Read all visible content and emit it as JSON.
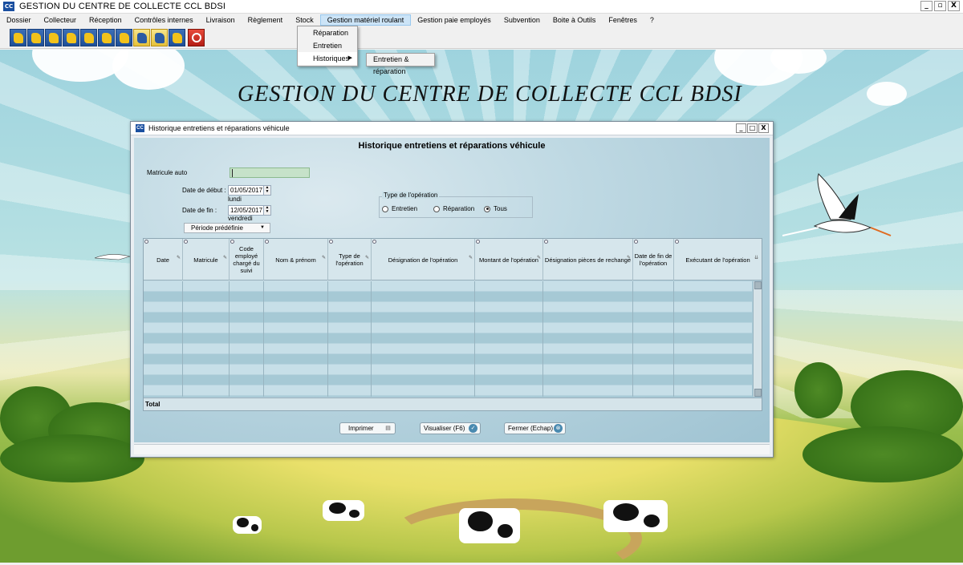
{
  "window": {
    "title": "GESTION  DU CENTRE DE COLLECTE CCL BDSI",
    "icon": "app-icon",
    "icon_text": "CC"
  },
  "window_controls": {
    "minimize": "_",
    "restore": "▫",
    "close": "X"
  },
  "menubar": {
    "items": [
      "Dossier",
      "Collecteur",
      "Réception",
      "Contrôles internes",
      "Livraison",
      "Règlement",
      "Stock",
      "Gestion matériel roulant",
      "Gestion paie employés",
      "Subvention",
      "Boite à Outils",
      "Fenêtres",
      "?"
    ],
    "active_index": 7
  },
  "dropdown": {
    "items": [
      "Réparation",
      "Entretien",
      "Historiques"
    ],
    "submenu_arrow": "▶",
    "submenu": [
      "Entretien & réparation"
    ]
  },
  "toolbar": {
    "buttons": [
      "collecteur-icon",
      "reception-icon",
      "controle-icon",
      "livraison-icon",
      "reglement-icon",
      "stock-icon",
      "vehicule-icon",
      "paie-icon",
      "subvention-icon",
      "outils-icon",
      "quit-icon"
    ]
  },
  "background": {
    "title": "GESTION  DU CENTRE DE COLLECTE CCL BDSI"
  },
  "child_window": {
    "title": "Historique entretiens et réparations véhicule",
    "icon_text": "CC",
    "controls": {
      "minimize": "_",
      "maximize": "□",
      "close": "X"
    },
    "heading": "Historique entretiens et réparations véhicule",
    "matricule_label": "Matricule auto",
    "matricule_value": "",
    "date_debut_label": "Date de début :",
    "date_debut_value": "01/05/2017",
    "date_debut_day": "lundi",
    "date_fin_label": "Date de fin :",
    "date_fin_value": "12/05/2017",
    "date_fin_day": "vendredi",
    "spin_up": "▲",
    "spin_down": "▼",
    "period_button": "Période prédéfinie",
    "period_caret": "▼",
    "operation_group": {
      "legend": "Type de l'opération",
      "options": [
        "Entretien",
        "Réparation",
        "Tous"
      ],
      "selected": "Tous"
    },
    "table": {
      "columns": [
        "Date",
        "Matricule",
        "Code employé chargé du suivi",
        "Nom & prénom",
        "Type de l'opération",
        "Désignation de l'opération",
        "Montant de l'opération",
        "Désignation pièces de rechange",
        "Date de fin de l'opération",
        "Exécutant de l'opération"
      ],
      "edit_glyph": "✎",
      "scroll_glyph": "⇊",
      "rows": [],
      "total_label": "Total"
    },
    "buttons": {
      "print": "Imprimer",
      "print_glyph": "▤",
      "view": "Visualiser (F6)",
      "view_glyph": "✓",
      "close": "Fermer (Echap)",
      "close_glyph": "⊗"
    }
  }
}
